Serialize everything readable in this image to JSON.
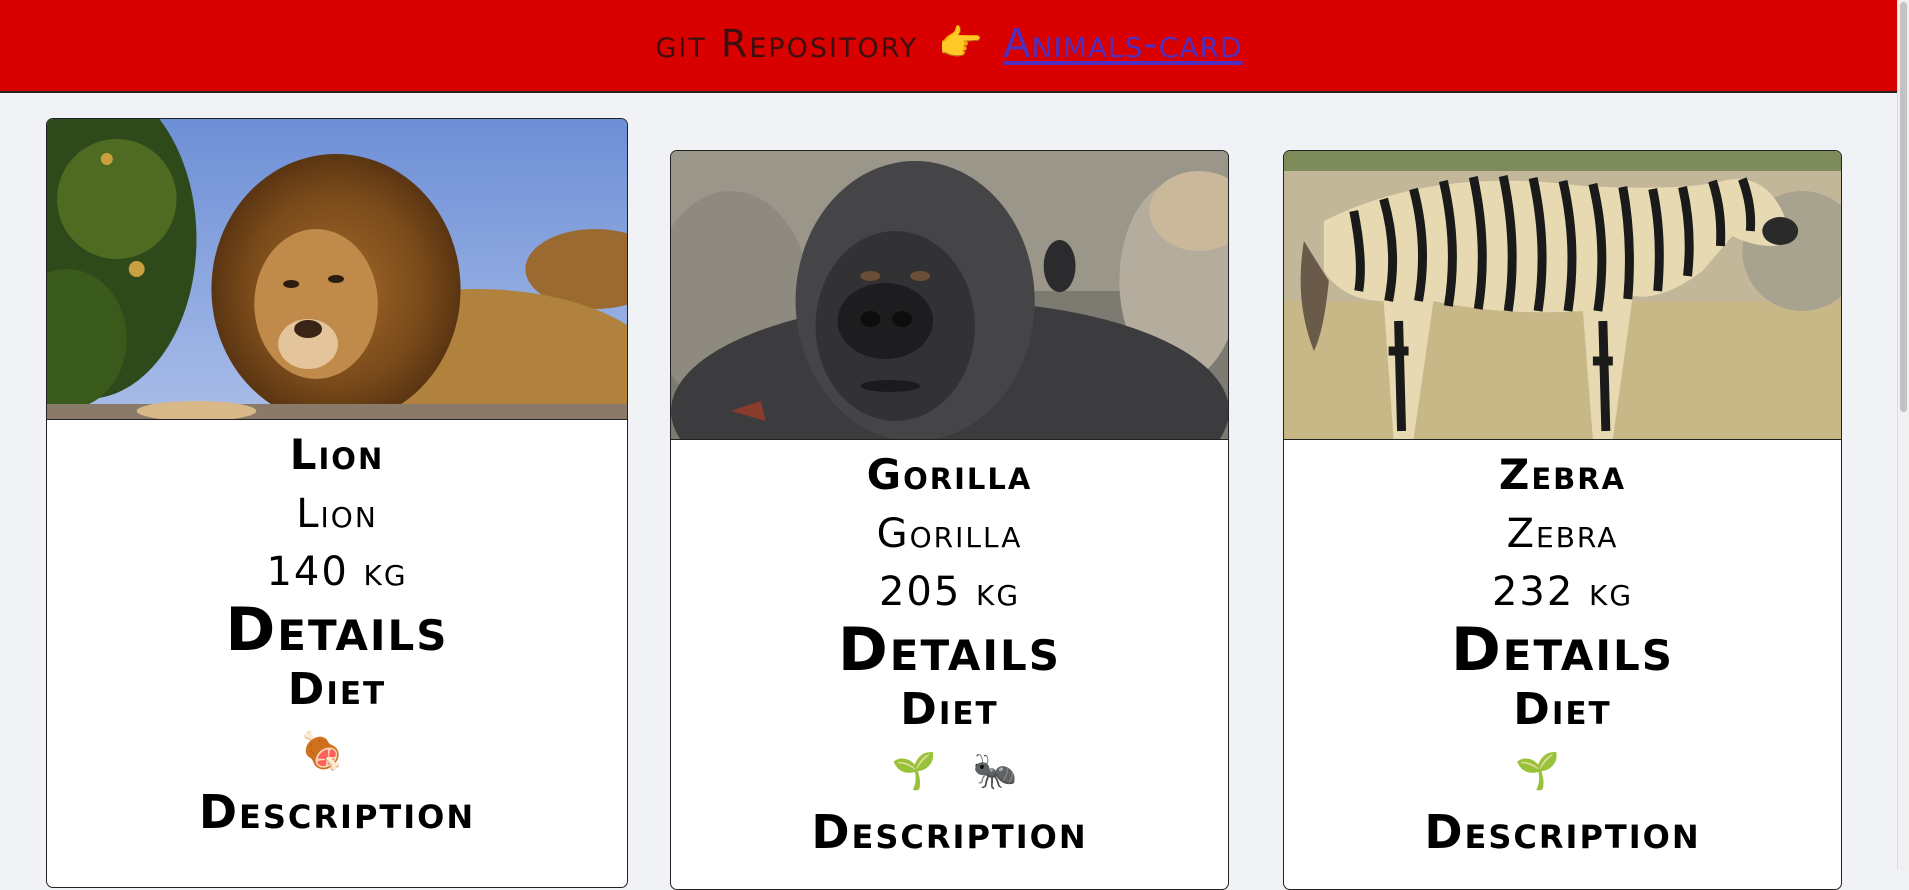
{
  "header": {
    "repo_label": "git Repository",
    "pointer_icon": "pointing-right-icon",
    "repo_link": "Animals-card"
  },
  "cards": [
    {
      "name": "Lion",
      "species": "Lion",
      "weight": "140 kg",
      "details_heading": "Details",
      "diet_heading": "Diet",
      "diet_icons": [
        "🍖"
      ],
      "diet_icon_names": [
        "meat-icon"
      ],
      "description_heading": "Description",
      "photo": "lion-photo"
    },
    {
      "name": "Gorilla",
      "species": "Gorilla",
      "weight": "205 kg",
      "details_heading": "Details",
      "diet_heading": "Diet",
      "diet_icons": [
        "🌱",
        "🐜"
      ],
      "diet_icon_names": [
        "seedling-icon",
        "ant-icon"
      ],
      "description_heading": "Description",
      "photo": "gorilla-photo"
    },
    {
      "name": "Zebra",
      "species": "Zebra",
      "weight": "232 kg",
      "details_heading": "Details",
      "diet_heading": "Diet",
      "diet_icons": [
        "🌱"
      ],
      "diet_icon_names": [
        "seedling-icon"
      ],
      "description_heading": "Description",
      "photo": "zebra-photo"
    }
  ],
  "colors": {
    "header_bg": "#d90000",
    "link": "#4f2fbf",
    "page_bg": "#f1f2f6"
  }
}
